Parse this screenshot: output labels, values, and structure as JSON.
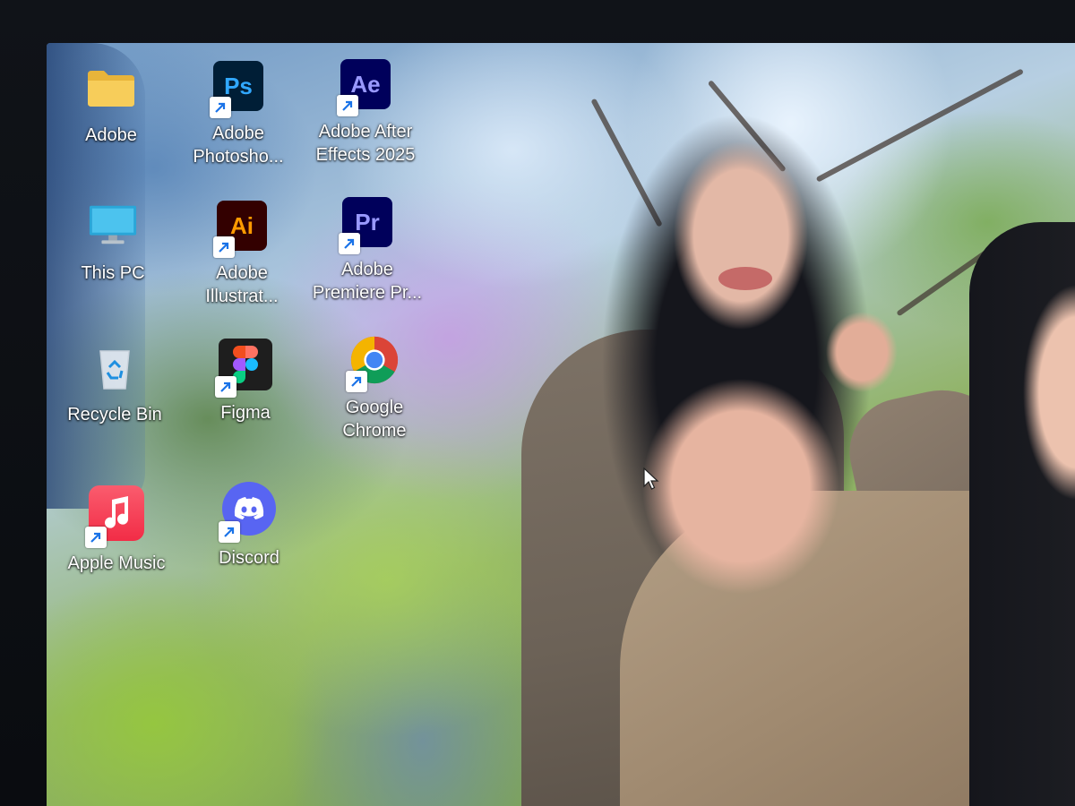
{
  "desktop": {
    "icons": [
      {
        "id": "adobe-folder",
        "label": "Adobe",
        "icon": "folder-icon"
      },
      {
        "id": "photoshop",
        "label": "Adobe\nPhotosho...",
        "line1": "Adobe",
        "line2": "Photosho...",
        "icon": "photoshop-icon",
        "glyph": "Ps"
      },
      {
        "id": "after-effects",
        "label": "Adobe After Effects 2025",
        "line1": "Adobe After",
        "line2": "Effects 2025",
        "icon": "after-effects-icon",
        "glyph": "Ae"
      },
      {
        "id": "this-pc",
        "label": "This PC",
        "icon": "monitor-icon"
      },
      {
        "id": "illustrator",
        "line1": "Adobe",
        "line2": "Illustrat...",
        "icon": "illustrator-icon",
        "glyph": "Ai"
      },
      {
        "id": "premiere",
        "line1": "Adobe",
        "line2": "Premiere Pr...",
        "icon": "premiere-icon",
        "glyph": "Pr"
      },
      {
        "id": "recycle-bin",
        "label": "Recycle Bin",
        "icon": "recycle-bin-icon"
      },
      {
        "id": "figma",
        "label": "Figma",
        "icon": "figma-icon"
      },
      {
        "id": "chrome",
        "line1": "Google",
        "line2": "Chrome",
        "icon": "chrome-icon"
      },
      {
        "id": "apple-music",
        "label": "Apple Music",
        "icon": "apple-music-icon"
      },
      {
        "id": "discord",
        "label": "Discord",
        "icon": "discord-icon"
      }
    ],
    "labels": {
      "adobe": "Adobe",
      "ps_1": "Adobe",
      "ps_2": "Photosho...",
      "ae_1": "Adobe After",
      "ae_2": "Effects 2025",
      "this_pc": "This PC",
      "ai_1": "Adobe",
      "ai_2": "Illustrat...",
      "pr_1": "Adobe",
      "pr_2": "Premiere Pr...",
      "recycle_bin": "Recycle Bin",
      "figma": "Figma",
      "chrome_1": "Google",
      "chrome_2": "Chrome",
      "apple_music": "Apple Music",
      "discord": "Discord"
    },
    "glyphs": {
      "ps": "Ps",
      "ae": "Ae",
      "ai": "Ai",
      "pr": "Pr"
    },
    "colors": {
      "ps_bg": "#001e36",
      "ps_fg": "#31a8ff",
      "ae_bg": "#00005b",
      "ae_fg": "#9999ff",
      "ai_bg": "#330000",
      "ai_fg": "#ff9a00",
      "pr_bg": "#00005b",
      "pr_fg": "#9999ff",
      "discord": "#5865f2",
      "apple_music": "#fa2d48",
      "folder": "#f4c542"
    }
  }
}
